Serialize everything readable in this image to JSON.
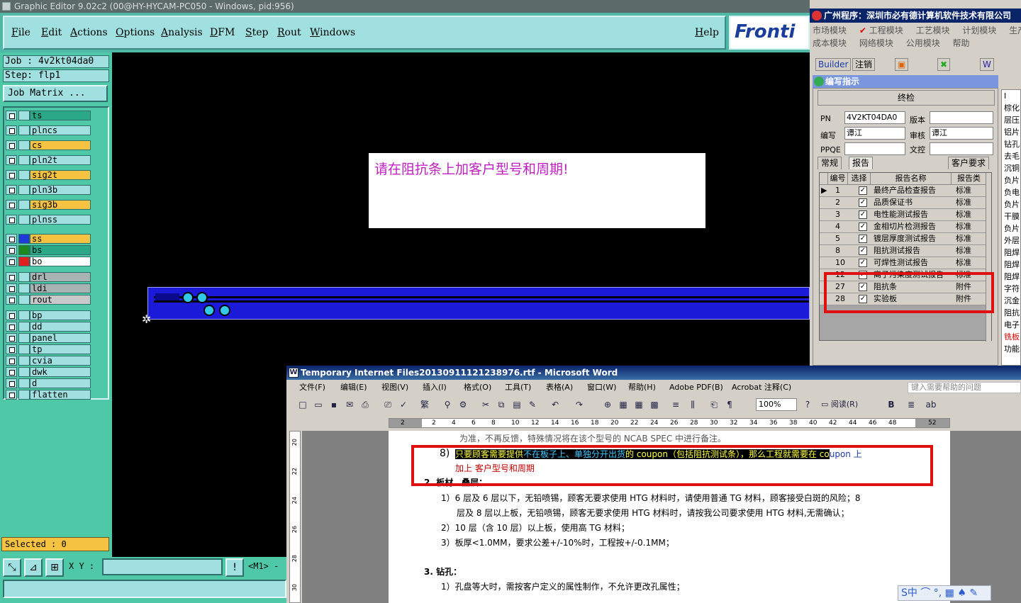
{
  "genesis": {
    "title": "Graphic Editor 9.02c2 (00@HY-HYCAM-PC050 - Windows, pid:956)",
    "menu": [
      "File",
      "Edit",
      "Actions",
      "Options",
      "Analysis",
      "DFM",
      "Step",
      "Rout",
      "Windows"
    ],
    "help": "Help",
    "logo": "Fronti",
    "job": "Job : 4v2kt04da0",
    "step": "Step: flp1",
    "job_matrix": "Job Matrix ...",
    "layers": [
      {
        "name": "ts",
        "color": "#2aa888"
      },
      {
        "name": "plncs",
        "color": "#a0e0e0"
      },
      {
        "name": "cs",
        "color": "#f5c242"
      },
      {
        "name": "pln2t",
        "color": "#a0e0e0"
      },
      {
        "name": "sig2t",
        "color": "#f5c242"
      },
      {
        "name": "pln3b",
        "color": "#a0e0e0"
      },
      {
        "name": "sig3b",
        "color": "#f5c242"
      },
      {
        "name": "plnss",
        "color": "#a0e0e0"
      },
      {
        "name": "ss",
        "color": "#f5c242",
        "swatch": "#1f3cd8"
      },
      {
        "name": "bs",
        "color": "#2aa888",
        "swatch": "#1e8a1e"
      },
      {
        "name": "bo",
        "color": "#ffffff",
        "swatch": "#e02020"
      },
      {
        "name": "drl",
        "color": "#a8b4b4"
      },
      {
        "name": "ldi",
        "color": "#a8b4b4"
      },
      {
        "name": "rout",
        "color": "#c8c8c8"
      },
      {
        "name": "bp",
        "color": "#a0e0e0"
      },
      {
        "name": "dd",
        "color": "#a0e0e0"
      },
      {
        "name": "panel",
        "color": "#a0e0e0"
      },
      {
        "name": "tp",
        "color": "#a0e0e0"
      },
      {
        "name": "cvia",
        "color": "#a0e0e0"
      },
      {
        "name": "dwk",
        "color": "#a0e0e0"
      },
      {
        "name": "d",
        "color": "#a0e0e0"
      },
      {
        "name": "flatten",
        "color": "#a0e0e0"
      }
    ],
    "selected": "Selected : 0",
    "xy_label": "X Y :",
    "m1": "<M1> -",
    "canvas_note": "请在阻抗条上加客户型号和周期!"
  },
  "erp": {
    "title": "广州程序：深圳市必有德计算机软件技术有限公司",
    "menu1": [
      "市场模块",
      "工程模块",
      "工艺模块",
      "计划模块",
      "生产"
    ],
    "menu2": [
      "成本模块",
      "网络模块",
      "公用模块",
      "帮助"
    ],
    "builder": "Builder",
    "cancel": "注销",
    "sub_title": "编写指示",
    "final_check": "终检",
    "pn_label": "PN",
    "pn_value": "4V2KT04DA0",
    "version_label": "版本",
    "writer_label": "编写",
    "writer_value": "谭江",
    "review_label": "审核",
    "review_value": "谭江",
    "ppqe_label": "PPQE",
    "doc_label": "文控",
    "tabs": [
      "常规",
      "报告",
      "客户要求"
    ],
    "grid_headers": [
      "编号",
      "选择",
      "报告名称",
      "报告类"
    ],
    "rows": [
      {
        "no": "1",
        "name": "最终产品检查报告",
        "type": "标准"
      },
      {
        "no": "2",
        "name": "品质保证书",
        "type": "标准"
      },
      {
        "no": "3",
        "name": "电性能测试报告",
        "type": "标准"
      },
      {
        "no": "4",
        "name": "金相切片检测报告",
        "type": "标准"
      },
      {
        "no": "5",
        "name": "镀层厚度测试报告",
        "type": "标准"
      },
      {
        "no": "8",
        "name": "阻抗测试报告",
        "type": "标准"
      },
      {
        "no": "10",
        "name": "可焊性测试报告",
        "type": "标准"
      },
      {
        "no": "12",
        "name": "离子污染度测试报告",
        "type": "标准"
      },
      {
        "no": "27",
        "name": "阻抗条",
        "type": "附件"
      },
      {
        "no": "28",
        "name": "实验板",
        "type": "附件"
      }
    ],
    "right_col": [
      "I",
      "棕化",
      "层压",
      "铝片",
      "钻孔",
      "去毛",
      "沉铜",
      "负片",
      "负电",
      "负片",
      "干膜",
      "负片",
      "外层",
      "阻焊",
      "阻焊",
      "阻焊",
      "字符",
      "沉金",
      "阻抗",
      "电子",
      "铣板",
      "功能"
    ]
  },
  "word": {
    "title": "Temporary Internet Files20130911121238976.rtf - Microsoft Word",
    "menu": [
      "文件(F)",
      "编辑(E)",
      "视图(V)",
      "插入(I)",
      "格式(O)",
      "工具(T)",
      "表格(A)",
      "窗口(W)",
      "帮助(H)",
      "Adobe PDF(B)",
      "Acrobat 注释(C)"
    ],
    "help_placeholder": "键入需要帮助的问题",
    "zoom": "100%",
    "read": "阅读(R)",
    "ruler": [
      "2",
      "2",
      "4",
      "6",
      "8",
      "10",
      "12",
      "14",
      "16",
      "18",
      "20",
      "22",
      "24",
      "26",
      "28",
      "30",
      "32",
      "34",
      "36",
      "38",
      "40",
      "42",
      "44",
      "46",
      "48",
      "52"
    ],
    "vruler": [
      "20",
      "22",
      "24",
      "26",
      "28",
      "30"
    ],
    "lines": {
      "l0": "为准，不再反馈，特殊情况将在该个型号的 NCAB SPEC 中进行备注。",
      "n8": "8)",
      "p8a_hl": "只要顾客需要提供",
      "p8a_blue": "不在板子上、单独分开出货",
      "p8a_rest": "的 coupon（包括阻抗测试条），那么工程就需要在 co",
      "p8a_tail": "upon 上",
      "p8b": "加上 客户型号和周期",
      "h2": "2.  板材、叠层：",
      "i1": "1）6 层及 6 层以下，无铅喷锡，顾客无要求使用 HTG 材料时，请使用普通 TG 材料，顾客接受白斑的风险；8",
      "i1b": "层及 8 层以上板，无铅喷锡，顾客无要求使用 HTG 材料时，请按我公司要求使用 HTG 材料,无需确认；",
      "i2": "2）10 层（含 10 层）以上板，使用高 TG 材料；",
      "i3": "3）板厚<1.0MM，要求公差+/-10%时，工程按+/-0.1MM；",
      "h3": "3.  钻孔：",
      "i4": "1）孔盘等大时，需按客户定义的属性制作，不允许更改孔属性；"
    },
    "tray": "S中 ⌒ °, ▦ ♠ ✎"
  }
}
